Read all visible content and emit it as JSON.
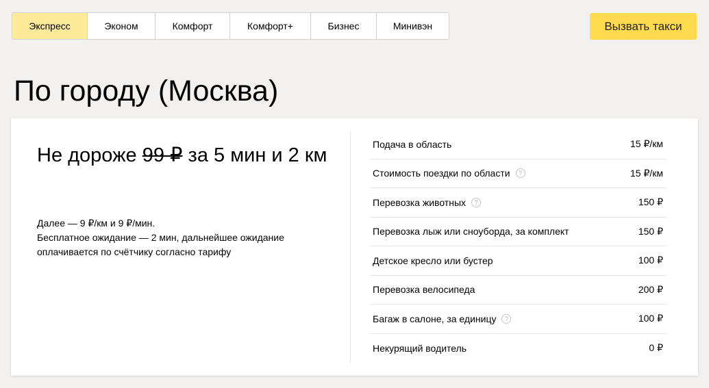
{
  "tabs": [
    {
      "label": "Экспресс",
      "active": true
    },
    {
      "label": "Эконом",
      "active": false
    },
    {
      "label": "Комфорт",
      "active": false
    },
    {
      "label": "Комфорт+",
      "active": false
    },
    {
      "label": "Бизнес",
      "active": false
    },
    {
      "label": "Минивэн",
      "active": false
    }
  ],
  "call_button_label": "Вызвать такси",
  "page_title": "По городу (Москва)",
  "tariff": {
    "headline_prefix": "Не дороже ",
    "headline_price": "99 ₽",
    "headline_suffix": " за 5 мин и 2 км",
    "detail_line1": "Далее — 9 ₽/км и 9 ₽/мин.",
    "detail_line2": "Бесплатное ожидание — 2 мин, дальнейшее ожидание оплачивается по счётчику согласно тарифу"
  },
  "extras": [
    {
      "label": "Подача в область",
      "price": "15 ₽/км",
      "help": false
    },
    {
      "label": "Стоимость поездки по области",
      "price": "15 ₽/км",
      "help": true
    },
    {
      "label": "Перевозка животных",
      "price": "150 ₽",
      "help": true
    },
    {
      "label": "Перевозка лыж или сноуборда, за комплект",
      "price": "150 ₽",
      "help": false
    },
    {
      "label": "Детское кресло или бустер",
      "price": "100 ₽",
      "help": false
    },
    {
      "label": "Перевозка велосипеда",
      "price": "200 ₽",
      "help": false
    },
    {
      "label": "Багаж в салоне, за единицу",
      "price": "100 ₽",
      "help": true
    },
    {
      "label": "Некурящий водитель",
      "price": "0 ₽",
      "help": false
    }
  ],
  "help_icon_glyph": "?",
  "colors": {
    "accent": "#ffdb4d",
    "active_tab": "#fdeb9a",
    "background": "#f2f1ef"
  }
}
